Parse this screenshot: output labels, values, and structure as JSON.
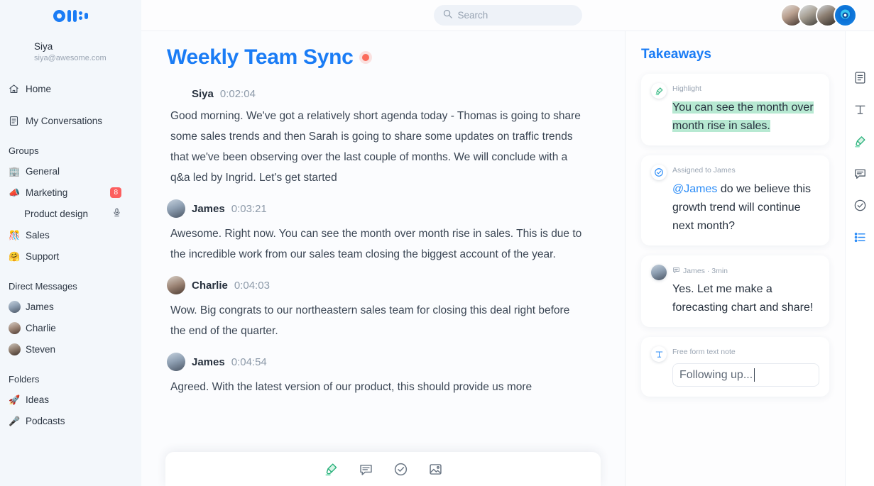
{
  "sidebar": {
    "logo_name": "otter-logo",
    "user": {
      "name": "Siya",
      "email": "siya@awesome.com"
    },
    "nav": [
      {
        "icon": "home-icon",
        "label": "Home"
      },
      {
        "icon": "conversations-icon",
        "label": "My Conversations"
      }
    ],
    "groups_title": "Groups",
    "groups": [
      {
        "emoji": "🏢",
        "label": "General",
        "badge": "",
        "mic": false
      },
      {
        "emoji": "📣",
        "label": "Marketing",
        "badge": "8",
        "mic": false
      },
      {
        "emoji": "",
        "label": "Product design",
        "badge": "",
        "mic": true
      },
      {
        "emoji": "🎊",
        "label": "Sales",
        "badge": "",
        "mic": false
      },
      {
        "emoji": "🤗",
        "label": "Support",
        "badge": "",
        "mic": false
      }
    ],
    "dm_title": "Direct Messages",
    "dms": [
      {
        "label": "James"
      },
      {
        "label": "Charlie"
      },
      {
        "label": "Steven"
      }
    ],
    "folders_title": "Folders",
    "folders": [
      {
        "emoji": "🚀",
        "label": "Ideas"
      },
      {
        "emoji": "🎤",
        "label": "Podcasts"
      }
    ]
  },
  "topbar": {
    "search_placeholder": "Search",
    "search_value": "",
    "avatars": [
      "participant-1",
      "participant-2",
      "participant-3",
      "record-button"
    ]
  },
  "transcript": {
    "title": "Weekly Team Sync",
    "recording": true,
    "segments": [
      {
        "speaker": "Siya",
        "time": "0:02:04",
        "avatar": false,
        "text": "Good morning. We've got a relatively short agenda today - Thomas is going to share some sales trends and then Sarah is going to share some updates on traffic trends that we've been observing over the last couple of months. We will conclude with a q&a led by Ingrid. Let's get started"
      },
      {
        "speaker": "James",
        "time": "0:03:21",
        "avatar": true,
        "text": "Awesome. Right now. You can see the month over month rise in sales. This is due to the incredible work from our sales team closing the biggest account of the year."
      },
      {
        "speaker": "Charlie",
        "time": "0:04:03",
        "avatar": true,
        "text": "Wow. Big congrats to our northeastern sales team for closing this deal right before the end of the quarter."
      },
      {
        "speaker": "James",
        "time": "0:04:54",
        "avatar": true,
        "text": "Agreed. With the latest version of our product, this should provide us more"
      }
    ],
    "toolbar": [
      "highlighter-icon",
      "comment-icon",
      "action-item-icon",
      "image-icon"
    ]
  },
  "takeaways": {
    "title": "Takeaways",
    "cards": [
      {
        "type": "highlight",
        "icon": "highlighter-icon",
        "meta": "Highlight",
        "text": "You can see the month over month rise in sales."
      },
      {
        "type": "action",
        "icon": "check-circle-icon",
        "meta": "Assigned to James",
        "mention": "@James",
        "text": " do we believe this growth trend will continue next month?"
      },
      {
        "type": "comment",
        "icon": "comment-icon",
        "meta": "James · 3min",
        "text": "Yes. Let me make a forecasting chart and share!"
      },
      {
        "type": "note",
        "icon": "text-icon",
        "meta": "Free form text note",
        "value": "Following up..."
      }
    ]
  },
  "rail": {
    "items": [
      "transcript-icon",
      "text-note-icon",
      "highlighter-icon",
      "comment-icon",
      "action-item-icon",
      "outline-icon"
    ],
    "active": "outline-icon"
  },
  "colors": {
    "brand_blue": "#1a7cf5",
    "highlight_green": "#b7e9d2",
    "badge_red": "#fc5f5f",
    "record_red": "#fb6b5b",
    "sidebar_bg": "#f3f7fb"
  }
}
